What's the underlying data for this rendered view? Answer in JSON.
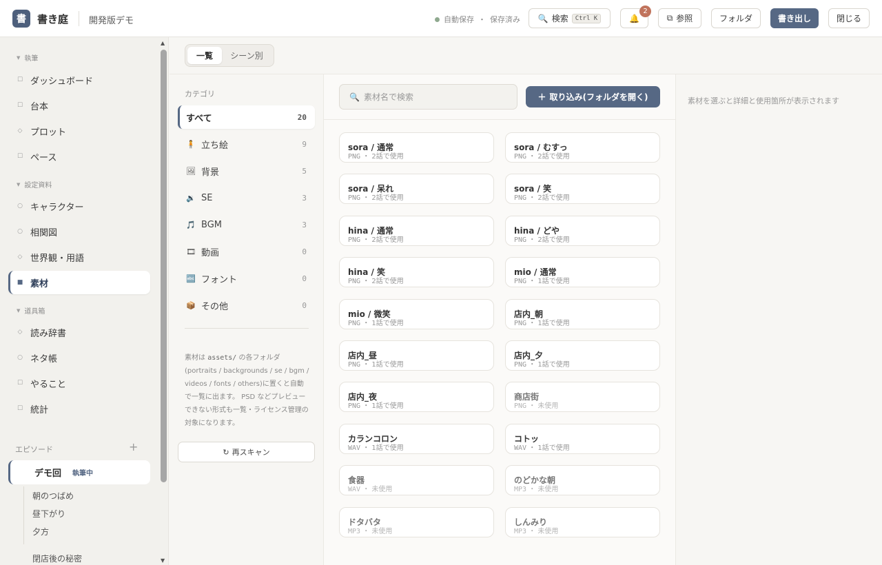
{
  "header": {
    "logo_char": "書",
    "app_title": "書き庭",
    "project_name": "開発版デモ",
    "autosave_label": "自動保存",
    "save_status": "保存済み",
    "search_label": "検索",
    "search_shortcut": "Ctrl K",
    "notification_count": "2",
    "reference_label": "参照",
    "folder_label": "フォルダ",
    "export_label": "書き出し",
    "close_label": "閉じる"
  },
  "sidebar": {
    "sections": [
      {
        "label": "執筆",
        "items": [
          {
            "label": "ダッシュボード",
            "icon": "square"
          },
          {
            "label": "台本",
            "icon": "square"
          },
          {
            "label": "プロット",
            "icon": "diamond"
          },
          {
            "label": "ペース",
            "icon": "square"
          }
        ]
      },
      {
        "label": "設定資料",
        "items": [
          {
            "label": "キャラクター",
            "icon": "circle"
          },
          {
            "label": "相関図",
            "icon": "circle"
          },
          {
            "label": "世界観・用語",
            "icon": "diamond"
          },
          {
            "label": "素材",
            "icon": "square",
            "active": true
          }
        ]
      },
      {
        "label": "道具箱",
        "items": [
          {
            "label": "読み辞書",
            "icon": "diamond"
          },
          {
            "label": "ネタ帳",
            "icon": "circle"
          },
          {
            "label": "やること",
            "icon": "square"
          },
          {
            "label": "統計",
            "icon": "square"
          }
        ]
      }
    ],
    "episodes_label": "エピソード",
    "episode": {
      "title": "デモ回",
      "status": "執筆中"
    },
    "scenes": [
      "朝のつばめ",
      "昼下がり",
      "夕方"
    ],
    "next_episode": "閉店後の秘密"
  },
  "tabs": {
    "list": "一覧",
    "by_scene": "シーン別"
  },
  "categories": {
    "heading": "カテゴリ",
    "items": [
      {
        "label": "すべて",
        "count": "20",
        "icon": "",
        "active": true
      },
      {
        "label": "立ち絵",
        "count": "9",
        "icon": "🧍"
      },
      {
        "label": "背景",
        "count": "5",
        "icon": "🖼"
      },
      {
        "label": "SE",
        "count": "3",
        "icon": "🔉"
      },
      {
        "label": "BGM",
        "count": "3",
        "icon": "🎵"
      },
      {
        "label": "動画",
        "count": "0",
        "icon": "🎞"
      },
      {
        "label": "フォント",
        "count": "0",
        "icon": "🔤"
      },
      {
        "label": "その他",
        "count": "0",
        "icon": "📦"
      }
    ],
    "note_prefix": "素材は ",
    "note_code": "assets/",
    "note_suffix": " の各フォルダ(portraits / backgrounds / se / bgm / videos / fonts / others)に置くと自動で一覧に出ます。 PSD などプレビューできない形式も一覧・ライセンス管理の対象になります。",
    "rescan_label": "再スキャン"
  },
  "assets": {
    "search_placeholder": "素材名で検索",
    "import_label": "取り込み(フォルダを開く)",
    "items": [
      {
        "name": "sora / 通常",
        "format": "PNG",
        "usage": "2話で使用"
      },
      {
        "name": "sora / むすっ",
        "format": "PNG",
        "usage": "2話で使用"
      },
      {
        "name": "sora / 呆れ",
        "format": "PNG",
        "usage": "2話で使用"
      },
      {
        "name": "sora / 笑",
        "format": "PNG",
        "usage": "2話で使用"
      },
      {
        "name": "hina / 通常",
        "format": "PNG",
        "usage": "2話で使用"
      },
      {
        "name": "hina / どや",
        "format": "PNG",
        "usage": "2話で使用"
      },
      {
        "name": "hina / 笑",
        "format": "PNG",
        "usage": "2話で使用"
      },
      {
        "name": "mio / 通常",
        "format": "PNG",
        "usage": "1話で使用"
      },
      {
        "name": "mio / 微笑",
        "format": "PNG",
        "usage": "1話で使用"
      },
      {
        "name": "店内_朝",
        "format": "PNG",
        "usage": "1話で使用"
      },
      {
        "name": "店内_昼",
        "format": "PNG",
        "usage": "1話で使用"
      },
      {
        "name": "店内_夕",
        "format": "PNG",
        "usage": "1話で使用"
      },
      {
        "name": "店内_夜",
        "format": "PNG",
        "usage": "1話で使用"
      },
      {
        "name": "商店街",
        "format": "PNG",
        "usage": "未使用",
        "unused": true
      },
      {
        "name": "カランコロン",
        "format": "WAV",
        "usage": "1話で使用"
      },
      {
        "name": "コトッ",
        "format": "WAV",
        "usage": "1話で使用"
      },
      {
        "name": "食器",
        "format": "WAV",
        "usage": "未使用",
        "unused": true
      },
      {
        "name": "のどかな朝",
        "format": "MP3",
        "usage": "未使用",
        "unused": true
      },
      {
        "name": "ドタバタ",
        "format": "MP3",
        "usage": "未使用",
        "unused": true
      },
      {
        "name": "しんみり",
        "format": "MP3",
        "usage": "未使用",
        "unused": true
      }
    ]
  },
  "detail": {
    "placeholder": "素材を選ぶと詳細と使用箇所が表示されます"
  },
  "colors": {
    "accent": "#566884",
    "badge": "#c0735c",
    "saved_dot": "#8fa98f"
  }
}
